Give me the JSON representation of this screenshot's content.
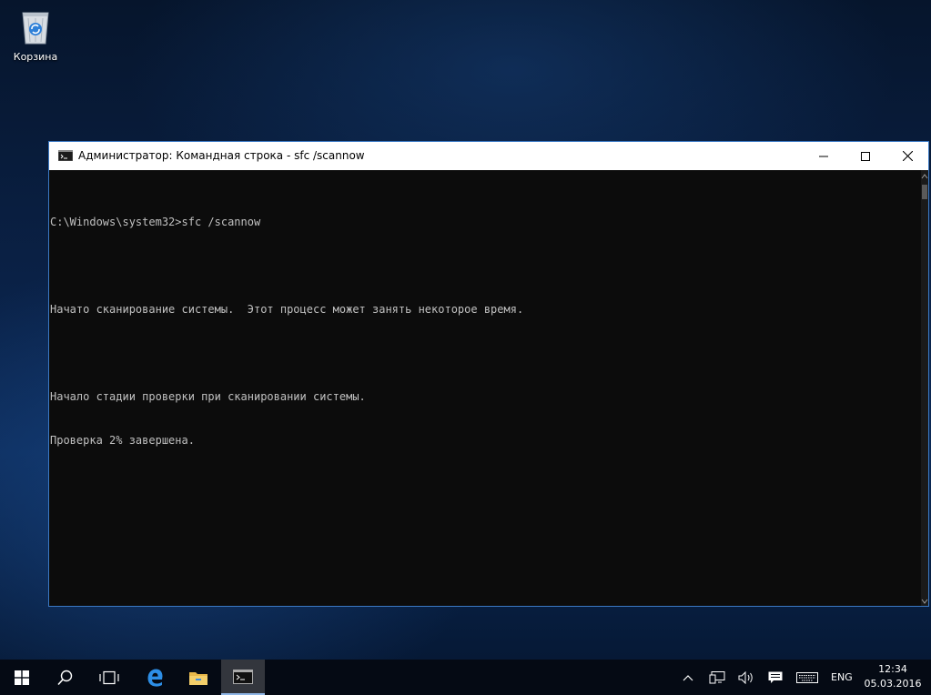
{
  "desktop": {
    "icons": [
      {
        "label": "Корзина",
        "icon": "recycle-bin-icon"
      }
    ]
  },
  "window": {
    "title": "Администратор: Командная строка - sfc  /scannow",
    "console_lines": [
      "C:\\Windows\\system32>sfc /scannow",
      "",
      "Начато сканирование системы.  Этот процесс может занять некоторое время.",
      "",
      "Начало стадии проверки при сканировании системы.",
      "Проверка 2% завершена."
    ]
  },
  "taskbar": {
    "language": "ENG",
    "time": "12:34",
    "date": "05.03.2016"
  },
  "colors": {
    "console_bg": "#0c0c0c",
    "console_text": "#c0c0c0",
    "window_border": "#3b79c4",
    "taskbar_bg": "#050a14"
  }
}
